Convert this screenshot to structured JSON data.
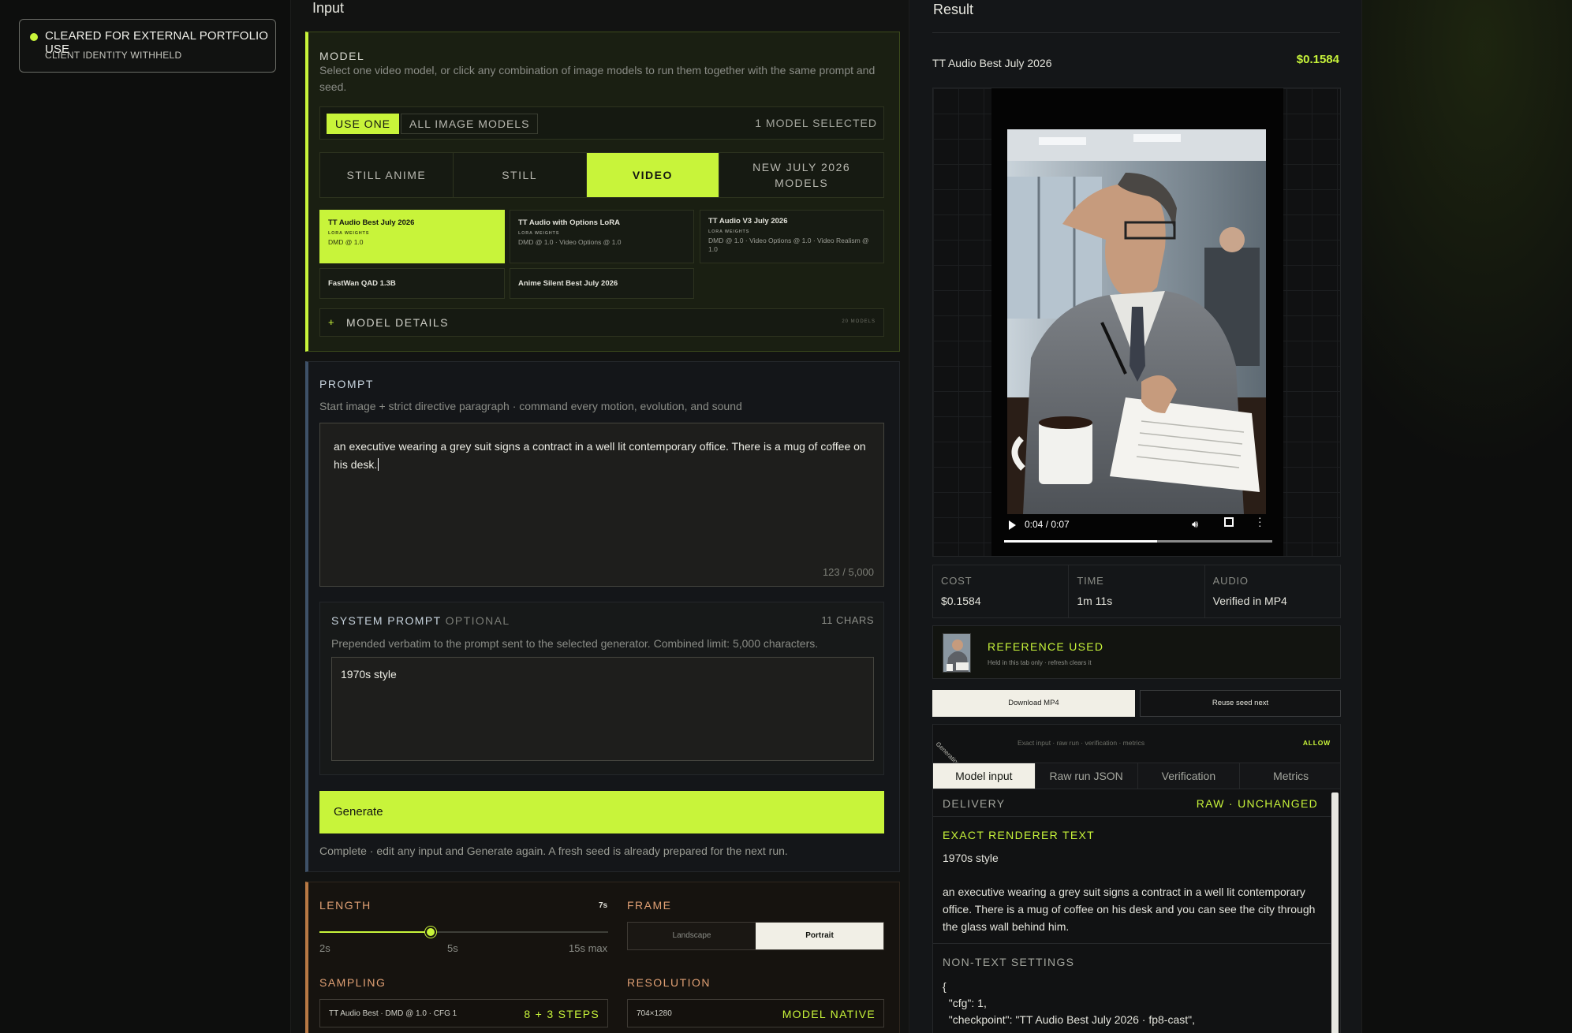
{
  "badge": {
    "line1": "CLEARED FOR EXTERNAL PORTFOLIO USE",
    "line2": "CLIENT IDENTITY WITHHELD"
  },
  "input": {
    "title": "Input",
    "model": {
      "label": "MODEL",
      "description": "Select one video model, or click any combination of image models to run them together with the same prompt and seed.",
      "mode_use_one": "USE ONE",
      "mode_all_image": "ALL IMAGE MODELS",
      "selected_count": "1 MODEL SELECTED",
      "type_tabs": [
        "STILL ANIME",
        "STILL",
        "VIDEO",
        "NEW JULY 2026 MODELS"
      ],
      "active_type": "VIDEO",
      "cards": [
        {
          "name": "TT Audio Best July 2026",
          "weights": "LORA WEIGHTS",
          "specs": "DMD @ 1.0",
          "selected": true
        },
        {
          "name": "TT Audio with Options LoRA",
          "weights": "LORA WEIGHTS",
          "specs": "DMD @ 1.0 · Video Options @ 1.0",
          "selected": false
        },
        {
          "name": "TT Audio V3 July 2026",
          "weights": "LORA WEIGHTS",
          "specs": "DMD @ 1.0 · Video Options @ 1.0 · Video Realism @ 1.0",
          "selected": false
        },
        {
          "name": "FastWan QAD 1.3B",
          "selected": false
        },
        {
          "name": "Anime Silent Best July 2026",
          "selected": false
        }
      ],
      "details_plus": "+",
      "details_label": "MODEL DETAILS",
      "details_count": "20 MODELS"
    },
    "prompt": {
      "label": "PROMPT",
      "description": "Start image + strict directive paragraph · command every motion, evolution, and sound",
      "text": "an executive wearing a grey suit signs a contract in a well lit contemporary office.  There is a mug of coffee on his desk.",
      "count": "123 / 5,000"
    },
    "system_prompt": {
      "label": "SYSTEM PROMPT",
      "optional": "OPTIONAL",
      "chars": "11 CHARS",
      "description": "Prepended verbatim to the prompt sent to the selected generator. Combined limit: 5,000 characters.",
      "value": "1970s style"
    },
    "generate_label": "Generate",
    "generate_note": "Complete · edit any input and Generate again. A fresh seed is already prepared for the next run.",
    "length": {
      "label": "LENGTH",
      "value": "7s",
      "fraction": 0.3846,
      "ticks": [
        "2s",
        "5s",
        "15s max"
      ]
    },
    "frame": {
      "label": "FRAME",
      "options": [
        "Landscape",
        "Portrait"
      ],
      "selected": "Portrait"
    },
    "sampling": {
      "label": "SAMPLING",
      "value": "TT Audio Best · DMD @ 1.0 · CFG 1",
      "steps": "8 + 3 STEPS"
    },
    "resolution": {
      "label": "RESOLUTION",
      "value": "704×1280",
      "note": "MODEL NATIVE"
    }
  },
  "result": {
    "title": "Result",
    "model_name": "TT Audio Best July 2026",
    "price": "$0.1584",
    "video": {
      "time": "0:04 / 0:07",
      "progress": 0.57
    },
    "stats": [
      {
        "key": "COST",
        "value": "$0.1584"
      },
      {
        "key": "TIME",
        "value": "1m 11s"
      },
      {
        "key": "AUDIO",
        "value": "Verified in MP4"
      }
    ],
    "reference": {
      "title": "REFERENCE USED",
      "subtitle": "Held in this tab only · refresh clears it"
    },
    "download_label": "Download MP4",
    "reuse_label": "Reuse seed next",
    "details": {
      "ribbon": "Generation details",
      "meta": "Exact input · raw run · verification · metrics",
      "allow": "ALLOW",
      "tabs": [
        "Model input",
        "Raw run JSON",
        "Verification",
        "Metrics"
      ],
      "active_tab": "Model input",
      "delivery": "DELIVERY",
      "delivery_state": "RAW · UNCHANGED",
      "exact_label": "EXACT RENDERER TEXT",
      "exact_line1": "1970s style",
      "exact_line2": "an executive wearing a grey suit signs a contract in a well lit contemporary office.  There is a mug of coffee on his desk and you can see the city through the glass wall behind him.",
      "non_text_label": "NON-TEXT SETTINGS",
      "code": "{\n  \"cfg\": 1,\n  \"checkpoint\": \"TT Audio Best July 2026 · fp8-cast\","
    }
  },
  "colors": {
    "accent": "#c8f43a",
    "background": "#0d0e0d",
    "prompt_border": "#3e5168",
    "length_border": "#b87944"
  }
}
